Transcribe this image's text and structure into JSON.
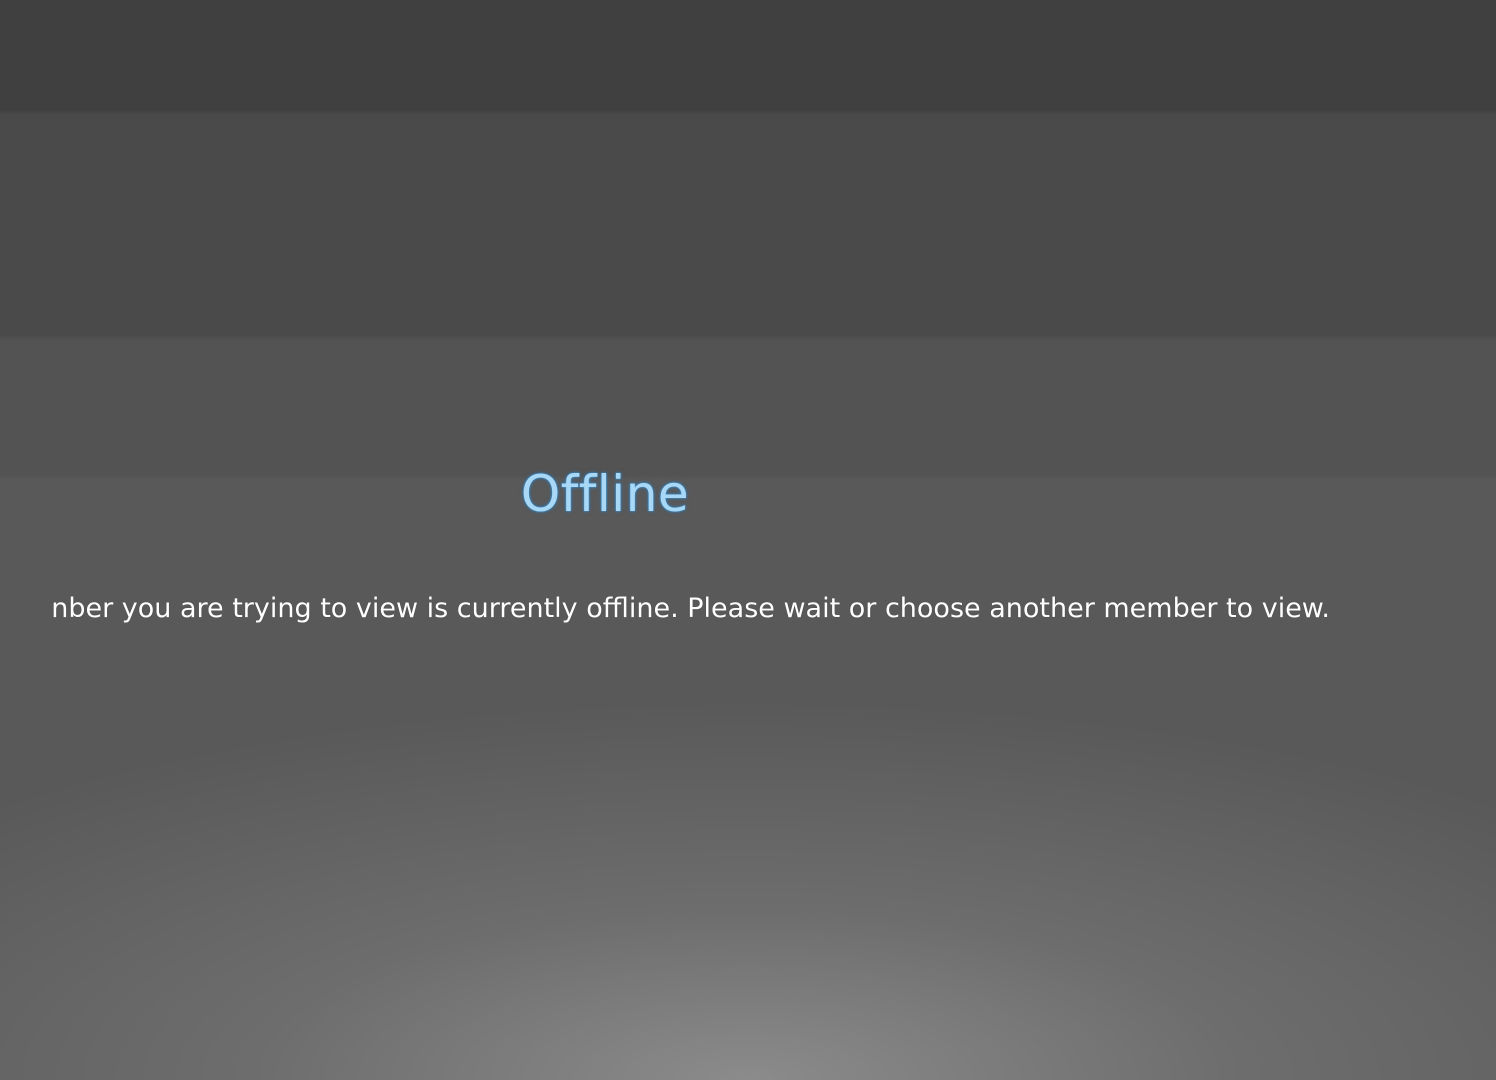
{
  "offline": {
    "title": "Offline",
    "message": "nber you are trying to view is currently offline. Please wait or choose another member to view."
  },
  "colors": {
    "title": "#a9d8f7",
    "title_glow": "#3f9ad8",
    "message": "#ffffff",
    "background_top": "#404040",
    "background_mid": "#595959"
  }
}
